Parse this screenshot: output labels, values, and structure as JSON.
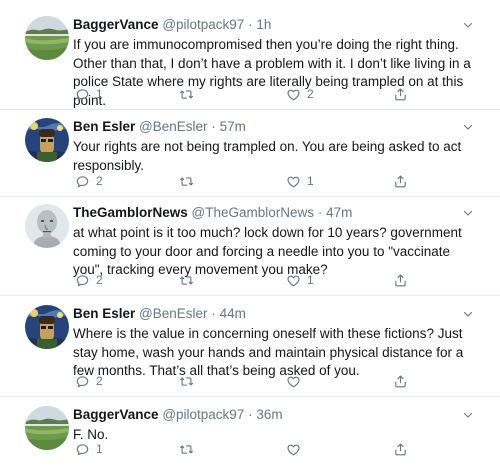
{
  "tweets": [
    {
      "display_name": "BaggerVance",
      "handle": "@pilotpack97",
      "time": "1h",
      "text": "If you are  immunocompromised then you’re doing the right thing. Other than that, I don’t have a problem with it. I don’t like living in a police State where my rights are literally being trampled on at this point.",
      "replies": "1",
      "retweets": "",
      "likes": "2",
      "avatar": "golf-course-avatar"
    },
    {
      "display_name": "Ben Esler",
      "handle": "@BenEsler",
      "time": "57m",
      "text": "Your rights are not being trampled on. You are being asked to act responsibly.",
      "replies": "2",
      "retweets": "",
      "likes": "1",
      "avatar": "starry-night-avatar"
    },
    {
      "display_name": "TheGamblorNews",
      "handle": "@TheGamblorNews",
      "time": "47m",
      "text": "at what point is it too much? lock down for 10 years? government coming to your door and forcing a needle into you to \"vaccinate you\", tracking every movement you make?",
      "replies": "2",
      "retweets": "",
      "likes": "1",
      "avatar": "npc-face-avatar"
    },
    {
      "display_name": "Ben Esler",
      "handle": "@BenEsler",
      "time": "44m",
      "text": "Where is the value in concerning oneself with these fictions? Just stay home, wash your hands and maintain physical distance for a few months. That’s all that’s being asked of you.",
      "replies": "2",
      "retweets": "",
      "likes": "",
      "avatar": "starry-night-avatar"
    },
    {
      "display_name": "BaggerVance",
      "handle": "@pilotpack97",
      "time": "36m",
      "text": "F. No.",
      "replies": "1",
      "retweets": "",
      "likes": "",
      "avatar": "golf-course-avatar"
    }
  ],
  "separator": "·",
  "colors": {
    "text": "#14171a",
    "secondary": "#657786",
    "divider": "#e6ecf0",
    "background": "#ffffff"
  },
  "icons": {
    "reply": "reply-icon",
    "retweet": "retweet-icon",
    "like": "heart-icon",
    "share": "share-icon",
    "more": "chevron-down-icon"
  }
}
